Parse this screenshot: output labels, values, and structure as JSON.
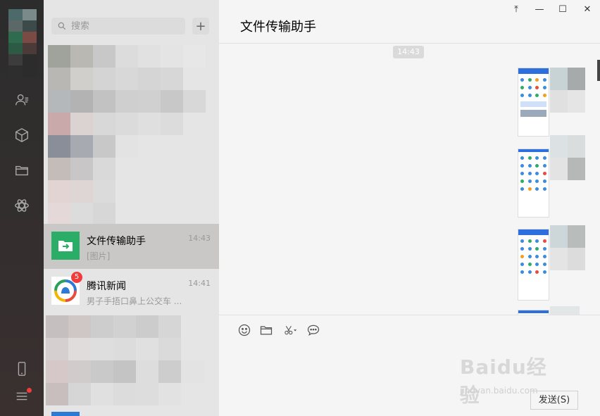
{
  "search": {
    "placeholder": "搜索"
  },
  "chatlist": {
    "items": [
      {
        "name": "文件传输助手",
        "time": "14:43",
        "preview": "[图片]"
      },
      {
        "name": "腾讯新闻",
        "time": "14:41",
        "preview": "男子手捂口鼻上公交车 ...",
        "badge": "5"
      }
    ]
  },
  "main": {
    "title": "文件传输助手",
    "timestamp": "14:43",
    "send_label": "发送(S)"
  },
  "window": {
    "pin": "⤒",
    "minimize": "—",
    "maximize": "☐",
    "close": "✕"
  },
  "watermark": {
    "logo": "Baidu经验",
    "url": "jingyan.baidu.com"
  },
  "colors": {
    "accent_green": "#2aae67",
    "badge_red": "#f23b3b",
    "sidebar_dark": "#2e2e2e"
  },
  "icons": [
    "search-icon",
    "plus-icon",
    "contacts-icon",
    "box-icon",
    "folder-icon",
    "mini-program-icon",
    "phone-icon",
    "menu-icon",
    "emoji-icon",
    "folder-icon",
    "scissors-icon",
    "chat-icon"
  ]
}
